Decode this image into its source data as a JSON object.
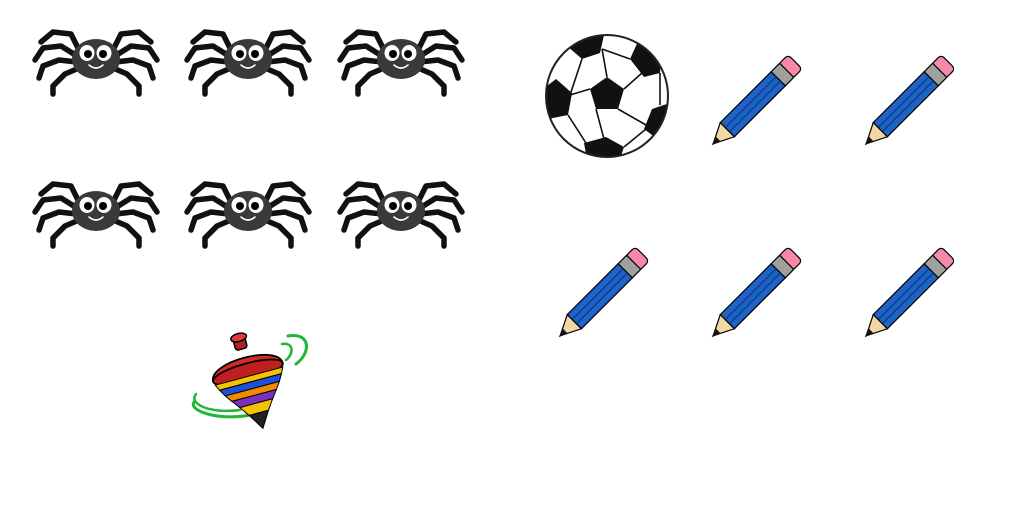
{
  "groups": [
    {
      "item": "spider",
      "count": 6
    },
    {
      "item": "spinning-top",
      "count": 1
    },
    {
      "item": "soccer-ball",
      "count": 1
    },
    {
      "item": "pencil",
      "count": 5
    }
  ],
  "colors": {
    "spider_body": "#3a3a3a",
    "spider_legs": "#111111",
    "top_body": "#d42a2a",
    "top_stripes": [
      "#f5c400",
      "#1f4fd6",
      "#7a2fbf",
      "#f28a00"
    ],
    "top_swirl": "#22b53a",
    "pencil_body": "#1e63c8",
    "pencil_eraser": "#f48aa8",
    "pencil_band": "#a0a0a0",
    "pencil_wood": "#f3d7a2",
    "ball_black": "#111111"
  },
  "icons": [
    "spider-icon",
    "spinning-top-icon",
    "soccer-ball-icon",
    "pencil-icon"
  ]
}
